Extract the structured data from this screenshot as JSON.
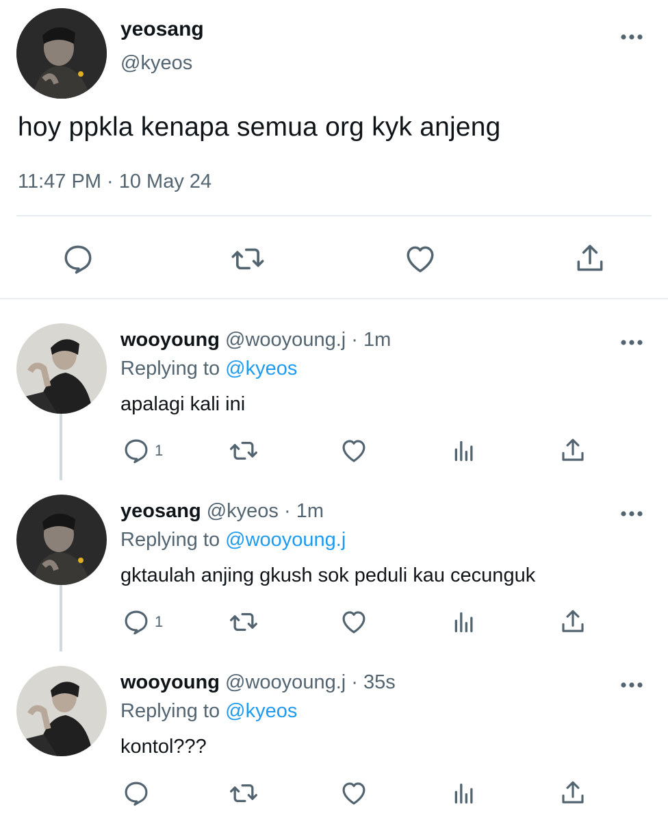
{
  "main_tweet": {
    "name": "yeosang",
    "handle": "@kyeos",
    "text": "hoy ppkla kenapa semua org kyk anjeng",
    "timestamp": "11:47 PM · 10 May 24",
    "avatar_icon": "avatar-photo-icon",
    "actions": [
      "reply-icon",
      "retweet-icon",
      "like-icon",
      "share-icon"
    ]
  },
  "replies": [
    {
      "name": "wooyoung",
      "meta": "@wooyoung.j · 1m",
      "replying_label": "Replying to",
      "replying_to": "@kyeos",
      "text": "apalagi kali ini",
      "reply_count": "1"
    },
    {
      "name": "yeosang",
      "meta": "@kyeos · 1m",
      "replying_label": "Replying to",
      "replying_to": "@wooyoung.j",
      "text": "gktaulah anjing gkush sok peduli kau cecunguk",
      "reply_count": "1"
    },
    {
      "name": "wooyoung",
      "meta": "@wooyoung.j · 35s",
      "replying_label": "Replying to",
      "replying_to": "@kyeos",
      "text": "kontol???",
      "reply_count": ""
    }
  ],
  "colors": {
    "text_primary": "#0f1419",
    "text_secondary": "#536471",
    "link": "#1d9bf0",
    "divider": "#e6ecf0",
    "thread_line": "#cfd9de"
  }
}
